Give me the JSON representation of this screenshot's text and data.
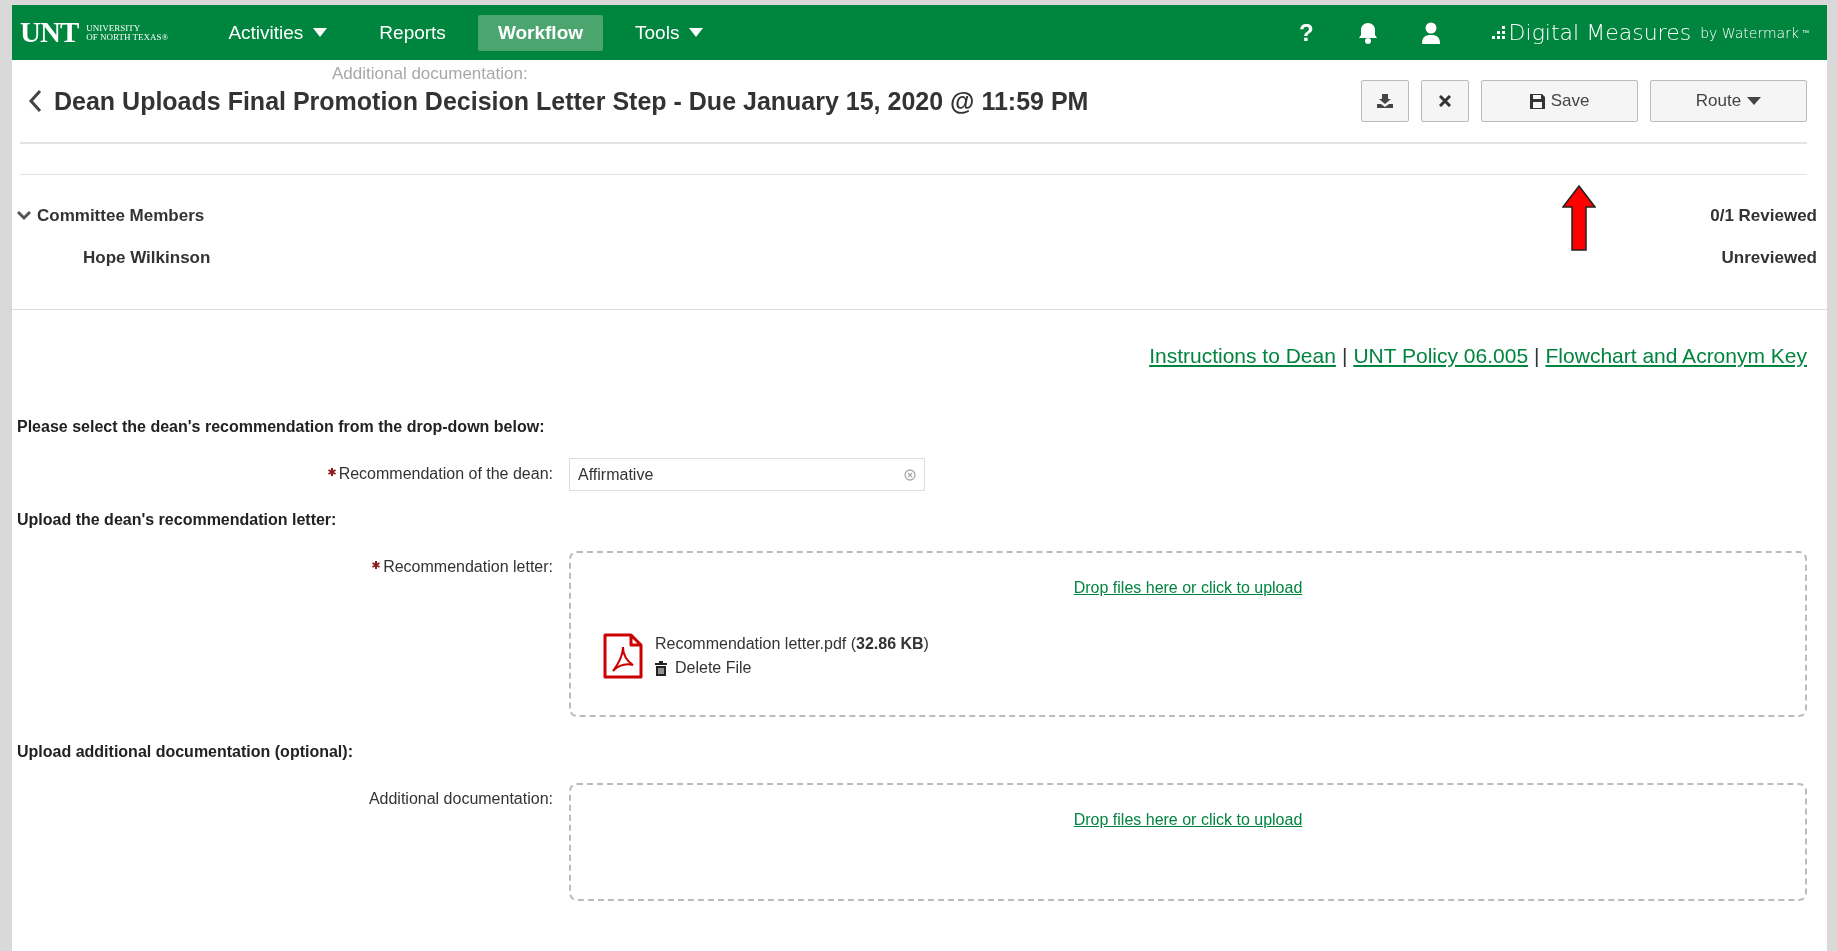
{
  "nav": {
    "logo": {
      "mark": "UNT",
      "line1": "UNIVERSITY",
      "line2": "OF NORTH TEXAS®"
    },
    "items": [
      {
        "label": "Activities",
        "has_menu": true,
        "selected": false
      },
      {
        "label": "Reports",
        "has_menu": false,
        "selected": false
      },
      {
        "label": "Workflow",
        "has_menu": false,
        "selected": true
      },
      {
        "label": "Tools",
        "has_menu": true,
        "selected": false
      }
    ],
    "help": "?",
    "brand": {
      "name": "Digital Measures",
      "by": "by Watermark",
      "tm": "™"
    }
  },
  "drag_ghost": "Additional documentation:",
  "header": {
    "title": "Dean Uploads Final Promotion Decision Letter Step - Due January 15, 2020 @ 11:59 PM",
    "buttons": [
      {
        "kind": "download"
      },
      {
        "kind": "close"
      },
      {
        "kind": "save",
        "label": "Save"
      },
      {
        "kind": "route",
        "label": "Route"
      }
    ]
  },
  "committee": {
    "title": "Committee Members",
    "expanded": true,
    "summary": "0/1 Reviewed",
    "members": [
      {
        "name": "Hope Wilkinson",
        "status": "Unreviewed"
      }
    ]
  },
  "links": [
    {
      "kind": "link",
      "text": "Instructions to Dean"
    },
    {
      "kind": "separator",
      "text": "|"
    },
    {
      "kind": "link",
      "text": "UNT Policy 06.005"
    },
    {
      "kind": "separator",
      "text": "|"
    },
    {
      "kind": "link",
      "text": "Flowchart and Acronym Key"
    }
  ],
  "sections": [
    {
      "heading": "Please select the dean's recommendation from the drop-down below:",
      "field": {
        "kind": "select",
        "label": "Recommendation of the dean:",
        "required": true,
        "value": "Affirmative"
      }
    },
    {
      "heading": "Upload the dean's recommendation letter:",
      "field": {
        "kind": "upload",
        "label": "Recommendation letter:",
        "required": true,
        "drop_text": "Drop files here or click to upload",
        "files": [
          {
            "text": "Recommendation letter.pdf (**32.86 KB**)",
            "delete": "Delete File"
          }
        ]
      }
    },
    {
      "heading": "Upload additional documentation (optional):",
      "field": {
        "kind": "upload",
        "label": "Additional documentation:",
        "required": false,
        "drop_text": "Drop files here or click to upload"
      }
    }
  ]
}
